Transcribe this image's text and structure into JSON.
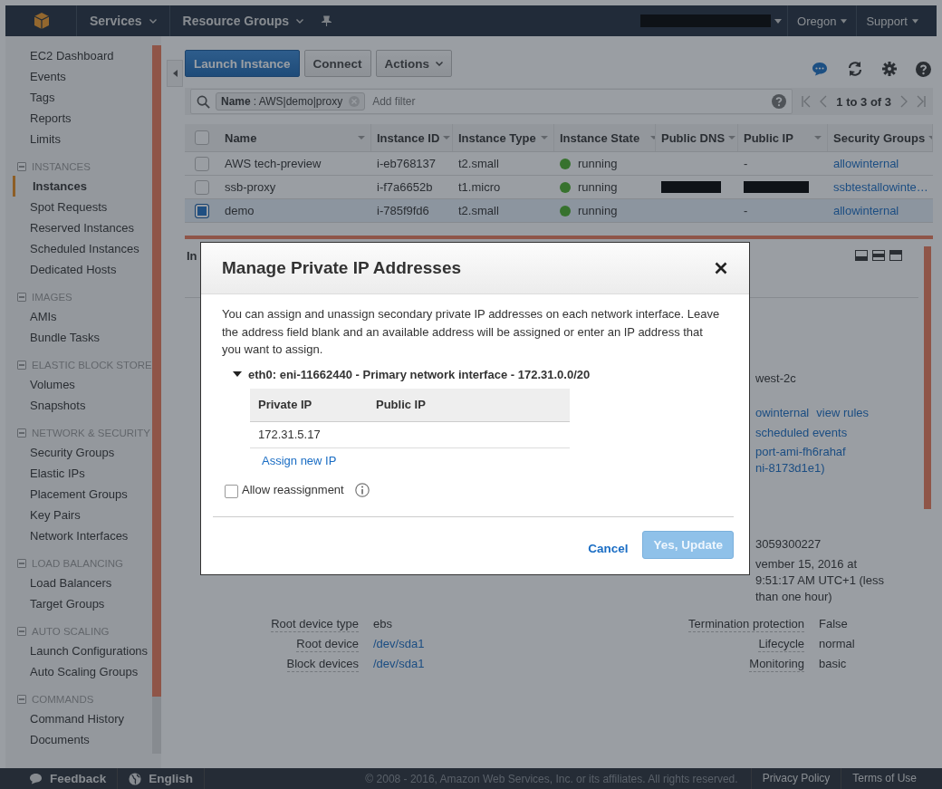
{
  "top_bar": {
    "menus": [
      {
        "label": "Services",
        "kind": "menu"
      },
      {
        "label": "Resource Groups",
        "kind": "menu"
      }
    ],
    "account_redacted": true,
    "right_menus": [
      "Oregon",
      "Support"
    ]
  },
  "sidebar": {
    "groups": [
      {
        "items": [
          {
            "label": "EC2 Dashboard",
            "selected": false
          },
          {
            "label": "Events",
            "selected": false
          },
          {
            "label": "Tags",
            "selected": false
          },
          {
            "label": "Reports",
            "selected": false
          },
          {
            "label": "Limits",
            "selected": false
          }
        ]
      },
      {
        "heading": "INSTANCES",
        "items": [
          {
            "label": "Instances",
            "selected": true
          },
          {
            "label": "Spot Requests",
            "selected": false
          },
          {
            "label": "Reserved Instances",
            "selected": false
          },
          {
            "label": "Scheduled Instances",
            "selected": false
          },
          {
            "label": "Dedicated Hosts",
            "selected": false
          }
        ]
      },
      {
        "heading": "IMAGES",
        "items": [
          {
            "label": "AMIs",
            "selected": false
          },
          {
            "label": "Bundle Tasks",
            "selected": false
          }
        ]
      },
      {
        "heading": "ELASTIC BLOCK STORE",
        "items": [
          {
            "label": "Volumes",
            "selected": false
          },
          {
            "label": "Snapshots",
            "selected": false
          }
        ]
      },
      {
        "heading": "NETWORK & SECURITY",
        "items": [
          {
            "label": "Security Groups",
            "selected": false
          },
          {
            "label": "Elastic IPs",
            "selected": false
          },
          {
            "label": "Placement Groups",
            "selected": false
          },
          {
            "label": "Key Pairs",
            "selected": false
          },
          {
            "label": "Network Interfaces",
            "selected": false
          }
        ]
      },
      {
        "heading": "LOAD BALANCING",
        "items": [
          {
            "label": "Load Balancers",
            "selected": false
          },
          {
            "label": "Target Groups",
            "selected": false
          }
        ]
      },
      {
        "heading": "AUTO SCALING",
        "items": [
          {
            "label": "Launch Configurations",
            "selected": false
          },
          {
            "label": "Auto Scaling Groups",
            "selected": false
          }
        ]
      },
      {
        "heading": "COMMANDS",
        "items": [
          {
            "label": "Command History",
            "selected": false
          },
          {
            "label": "Documents",
            "selected": false
          }
        ]
      }
    ]
  },
  "toolbar": {
    "buttons": [
      {
        "label": "Launch Instance",
        "kind": "primary"
      },
      {
        "label": "Connect",
        "kind": "plain"
      },
      {
        "label": "Actions",
        "kind": "dropdown"
      }
    ]
  },
  "filter": {
    "token_key": "Name",
    "token_value": ": AWS|demo|proxy",
    "placeholder": "Add filter",
    "pagination": "1 to 3 of 3"
  },
  "table": {
    "select_all": false,
    "columns": [
      "Name",
      "Instance ID",
      "Instance Type",
      "Instance State",
      "Public DNS",
      "Public IP",
      "Security Groups"
    ],
    "rows": [
      {
        "selected": false,
        "name": "AWS tech-preview",
        "id": "i-eb768137",
        "type": "t2.small",
        "state": "running",
        "public_dns_redacted": false,
        "public_ip": "-",
        "public_ip_redacted": false,
        "security_groups": [
          "allowinternal"
        ]
      },
      {
        "selected": false,
        "name": "ssb-proxy",
        "id": "i-f7a6652b",
        "type": "t1.micro",
        "state": "running",
        "public_dns_redacted": true,
        "public_ip_redacted": true,
        "security_groups": [
          "ssbtest",
          "allowinte…"
        ]
      },
      {
        "selected": true,
        "name": "demo",
        "id": "i-785f9fd6",
        "type": "t2.small",
        "state": "running",
        "public_dns_redacted": false,
        "public_ip": "-",
        "public_ip_redacted": false,
        "security_groups": [
          "allowinternal"
        ]
      }
    ]
  },
  "details": {
    "tab_fragment": "In",
    "peek": [
      {
        "kind": "text",
        "parts": [
          "west-2c"
        ]
      },
      {
        "kind": "links",
        "parts": [
          "owinternal",
          "view rules"
        ]
      },
      {
        "kind": "links",
        "parts": [
          "scheduled events"
        ]
      },
      {
        "kind": "links",
        "parts": [
          "port-ami-fh6rahaf"
        ]
      },
      {
        "kind": "links",
        "parts": [
          "ni-8173d1e1)"
        ]
      },
      {
        "kind": "text",
        "parts": [
          "3059300227"
        ]
      },
      {
        "kind": "text",
        "parts": [
          "vember 15, 2016 at 9:51:17 AM UTC+1 (less than one hour)"
        ]
      }
    ],
    "rows": [
      {
        "label": "Root device type",
        "value": "ebs",
        "link": false,
        "label2": "Termination protection",
        "value2": "False"
      },
      {
        "label": "Root device",
        "value": "/dev/sda1",
        "link": true,
        "label2": "Lifecycle",
        "value2": "normal"
      },
      {
        "label": "Block devices",
        "value": "/dev/sda1",
        "link": true,
        "label2": "Monitoring",
        "value2": "basic"
      }
    ]
  },
  "modal": {
    "title": "Manage Private IP Addresses",
    "description": "You can assign and unassign secondary private IP addresses on each network interface. Leave the address field blank and an available address will be assigned or enter an IP address that you want to assign.",
    "interface": {
      "label": "eth0: eni-11662440 - Primary network interface - 172.31.0.0/20",
      "expanded": true,
      "columns": [
        "Private IP",
        "Public IP"
      ],
      "rows": [
        [
          "172.31.5.17",
          ""
        ]
      ],
      "assign_link": "Assign new IP"
    },
    "allow_reassignment": {
      "label": "Allow reassignment",
      "checked": false
    },
    "cancel": "Cancel",
    "confirm": {
      "label": "Yes, Update",
      "disabled": true
    }
  },
  "footer": {
    "feedback": "Feedback",
    "language": "English",
    "copyright": "© 2008 - 2016, Amazon Web Services, Inc. or its affiliates. All rights reserved.",
    "links": [
      "Privacy Policy",
      "Terms of Use"
    ]
  }
}
